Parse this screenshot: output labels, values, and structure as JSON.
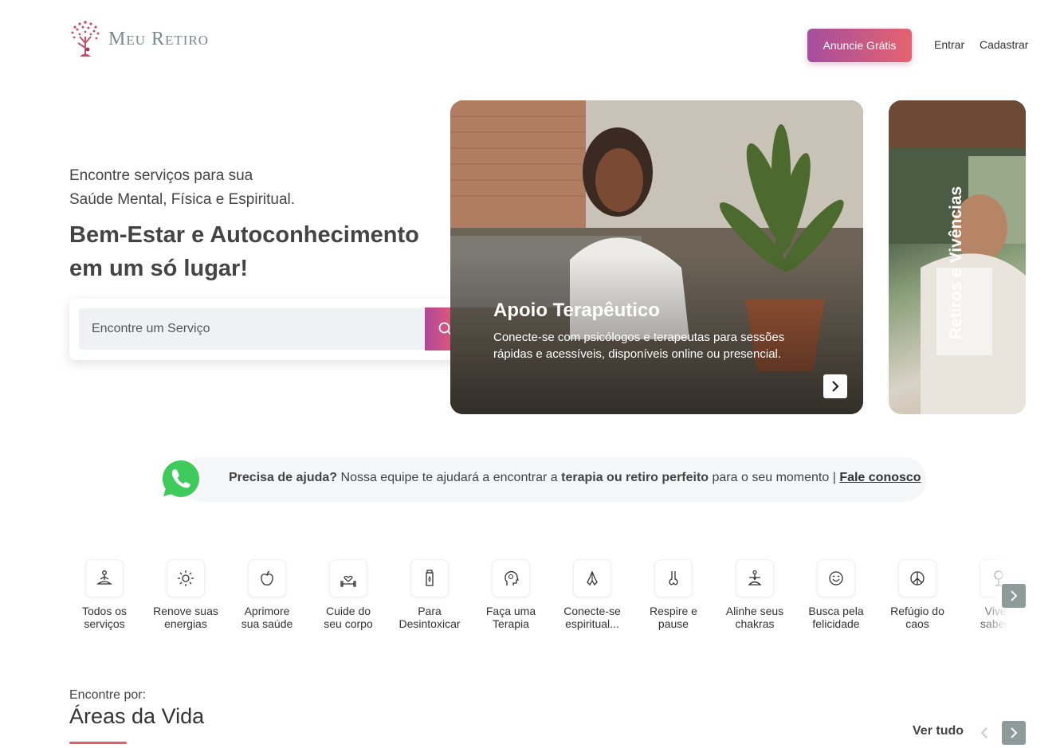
{
  "header": {
    "logo_text": "Meu Retiro",
    "cta_label": "Anuncie Grátis",
    "login_label": "Entrar",
    "signup_label": "Cadastrar"
  },
  "hero": {
    "subtitle_line1": "Encontre serviços para sua",
    "subtitle_line2": "Saúde Mental, Física e Espiritual.",
    "title_line1": "Bem-Estar e Autoconhecimento",
    "title_line2": "em um só lugar!",
    "search_placeholder": "Encontre um Serviço"
  },
  "cards": [
    {
      "title": "Apoio Terapêutico",
      "description": "Conecte-se com psicólogos e terapeutas para sessões rápidas e acessíveis, disponíveis online ou presencial."
    },
    {
      "title": "Retiros e Vivências"
    }
  ],
  "help": {
    "part1": "Precisa de ajuda?",
    "part2": " Nossa equipe te ajudará a encontrar a ",
    "part3": "terapia ou retiro perfeito",
    "part4": " para o seu momento | ",
    "link": "Fale conosco"
  },
  "categories": [
    {
      "line1": "Todos os",
      "line2": "serviços",
      "icon": "meditation-icon"
    },
    {
      "line1": "Renove suas",
      "line2": "energias",
      "icon": "sun-icon"
    },
    {
      "line1": "Aprimore",
      "line2": "sua saúde",
      "icon": "apple-icon"
    },
    {
      "line1": "Cuide do",
      "line2": "seu corpo",
      "icon": "dumbbell-heart-icon"
    },
    {
      "line1": "Para",
      "line2": "Desintoxicar",
      "icon": "bottle-icon"
    },
    {
      "line1": "Faça uma",
      "line2": "Terapia",
      "icon": "head-mind-icon"
    },
    {
      "line1": "Conecte-se",
      "line2": "espiritual...",
      "icon": "praying-hands-icon"
    },
    {
      "line1": "Respire e",
      "line2": "pause",
      "icon": "nose-icon"
    },
    {
      "line1": "Alinhe seus",
      "line2": "chakras",
      "icon": "chakra-icon"
    },
    {
      "line1": "Busca pela",
      "line2": "felicidade",
      "icon": "smile-icon"
    },
    {
      "line1": "Refúgio do",
      "line2": "caos",
      "icon": "peace-icon"
    },
    {
      "line1": "Viven",
      "line2": "sabedo",
      "icon": "tree-icon"
    }
  ],
  "areas": {
    "kicker": "Encontre por:",
    "title": "Áreas da Vida",
    "see_all": "Ver tudo"
  }
}
